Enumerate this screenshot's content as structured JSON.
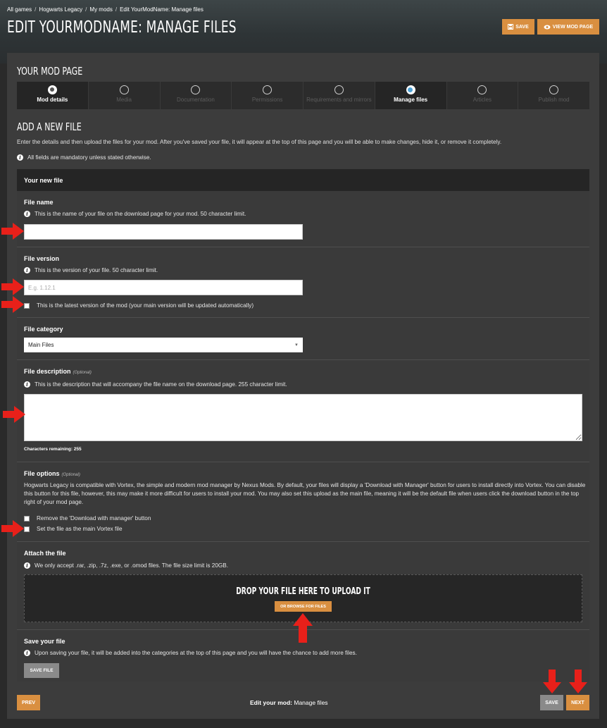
{
  "breadcrumb": {
    "items": [
      "All games",
      "Hogwarts Legacy",
      "My mods",
      "Edit YourModName: Manage files"
    ]
  },
  "header": {
    "title": "EDIT YOURMODNAME: MANAGE FILES",
    "save_label": "SAVE",
    "view_label": "VIEW MOD PAGE"
  },
  "mod_page": {
    "title": "YOUR MOD PAGE",
    "steps": [
      {
        "label": "Mod details",
        "state": "done"
      },
      {
        "label": "Media",
        "state": "pending"
      },
      {
        "label": "Documentation",
        "state": "pending"
      },
      {
        "label": "Permissions",
        "state": "pending"
      },
      {
        "label": "Requirements and mirrors",
        "state": "pending"
      },
      {
        "label": "Manage files",
        "state": "current"
      },
      {
        "label": "Articles",
        "state": "pending"
      },
      {
        "label": "Publish mod",
        "state": "pending"
      }
    ]
  },
  "add_file": {
    "title": "ADD A NEW FILE",
    "intro": "Enter the details and then upload the files for your mod. After you've saved your file, it will appear at the top of this page and you will be able to make changes, hide it, or remove it completely.",
    "mandatory_note": "All fields are mandatory unless stated otherwise.",
    "form_title": "Your new file"
  },
  "fields": {
    "file_name": {
      "label": "File name",
      "hint": "This is the name of your file on the download page for your mod. 50 character limit.",
      "value": ""
    },
    "file_version": {
      "label": "File version",
      "hint": "This is the version of your file. 50 character limit.",
      "placeholder": "E.g. 1.12.1",
      "latest_checkbox": "This is the latest version of the mod (your main version will be updated automatically)"
    },
    "file_category": {
      "label": "File category",
      "selected": "Main Files"
    },
    "file_description": {
      "label": "File description",
      "optional": "(Optional)",
      "hint": "This is the description that will accompany the file name on the download page. 255 character limit.",
      "chars_remaining": "Characters remaining: 255"
    },
    "file_options": {
      "label": "File options",
      "optional": "(Optional)",
      "description": "Hogwarts Legacy is compatible with Vortex, the simple and modern mod manager by Nexus Mods. By default, your files will display a 'Download with Manager' button for users to install directly into Vortex. You can disable this button for this file, however, this may make it more difficult for users to install your mod. You may also set this upload as the main file, meaning it will be the default file when users click the download button in the top right of your mod page.",
      "remove_download": "Remove the 'Download with manager' button",
      "main_vortex": "Set the file as the main Vortex file"
    },
    "attach": {
      "label": "Attach the file",
      "hint": "We only accept .rar, .zip, .7z, .exe, or .omod files. The file size limit is 20GB.",
      "drop_title": "DROP YOUR FILE HERE TO UPLOAD IT",
      "browse_label": "OR BROWSE FOR FILES"
    },
    "save_file": {
      "label": "Save your file",
      "hint": "Upon saving your file, it will be added into the categories at the top of this page and you will have the chance to add more files.",
      "button": "SAVE FILE"
    }
  },
  "footer": {
    "prev": "PREV",
    "edit_label": "Edit your mod:",
    "edit_value": "Manage files",
    "save": "SAVE",
    "next": "NEXT"
  },
  "colors": {
    "accent": "#d98f40",
    "annotation_arrow": "#e8201a",
    "step_current": "#4fa3d6"
  }
}
